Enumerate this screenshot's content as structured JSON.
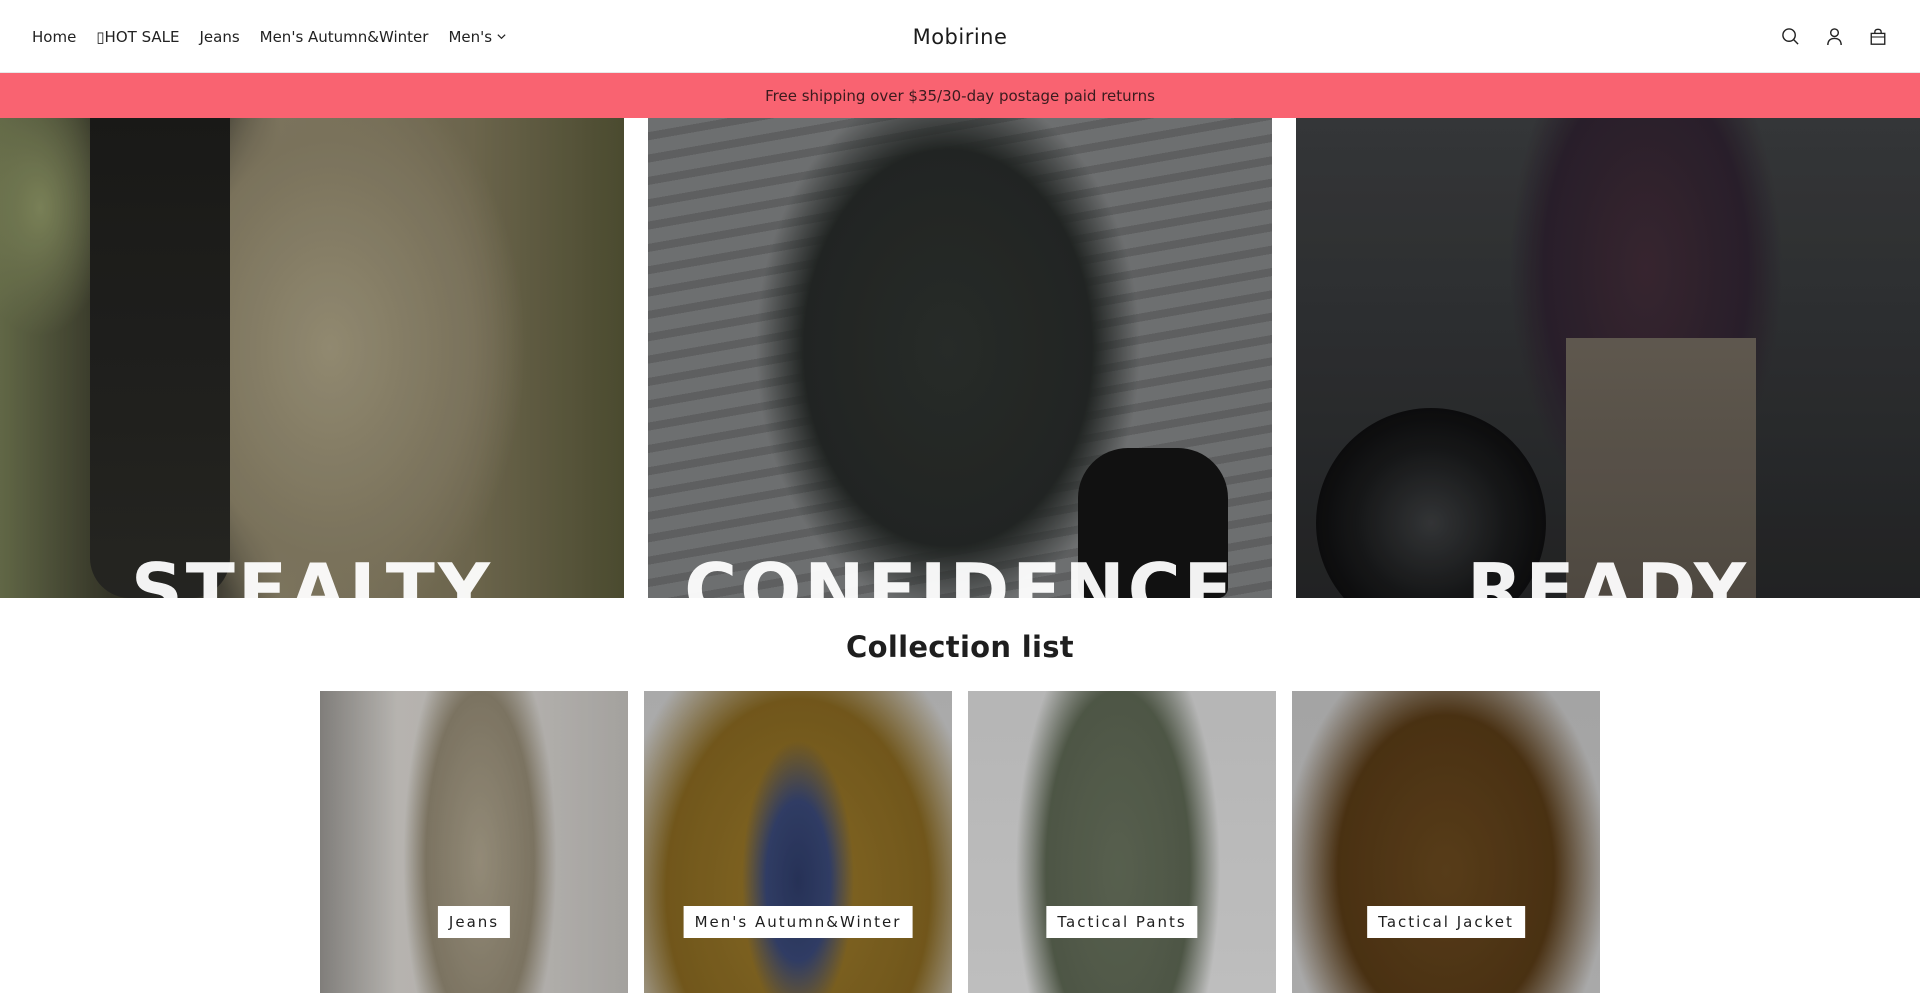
{
  "header": {
    "nav": [
      {
        "label": "Home"
      },
      {
        "label": "▯HOT SALE"
      },
      {
        "label": "Jeans"
      },
      {
        "label": "Men's Autumn&Winter"
      },
      {
        "label": "Men's",
        "has_dropdown": true
      }
    ],
    "brand": "Mobirine",
    "icons": [
      "search-icon",
      "account-icon",
      "cart-icon"
    ]
  },
  "announcement": {
    "text": "Free shipping over $35/30-day postage paid returns",
    "color": "#f96371"
  },
  "hero": {
    "panels": [
      {
        "word": "STEALTY"
      },
      {
        "word": "CONFIDENCE"
      },
      {
        "word": "READY"
      }
    ]
  },
  "collection": {
    "title": "Collection list",
    "items": [
      {
        "label": "Jeans"
      },
      {
        "label": "Men's Autumn&Winter"
      },
      {
        "label": "Tactical Pants"
      },
      {
        "label": "Tactical Jacket"
      }
    ]
  }
}
